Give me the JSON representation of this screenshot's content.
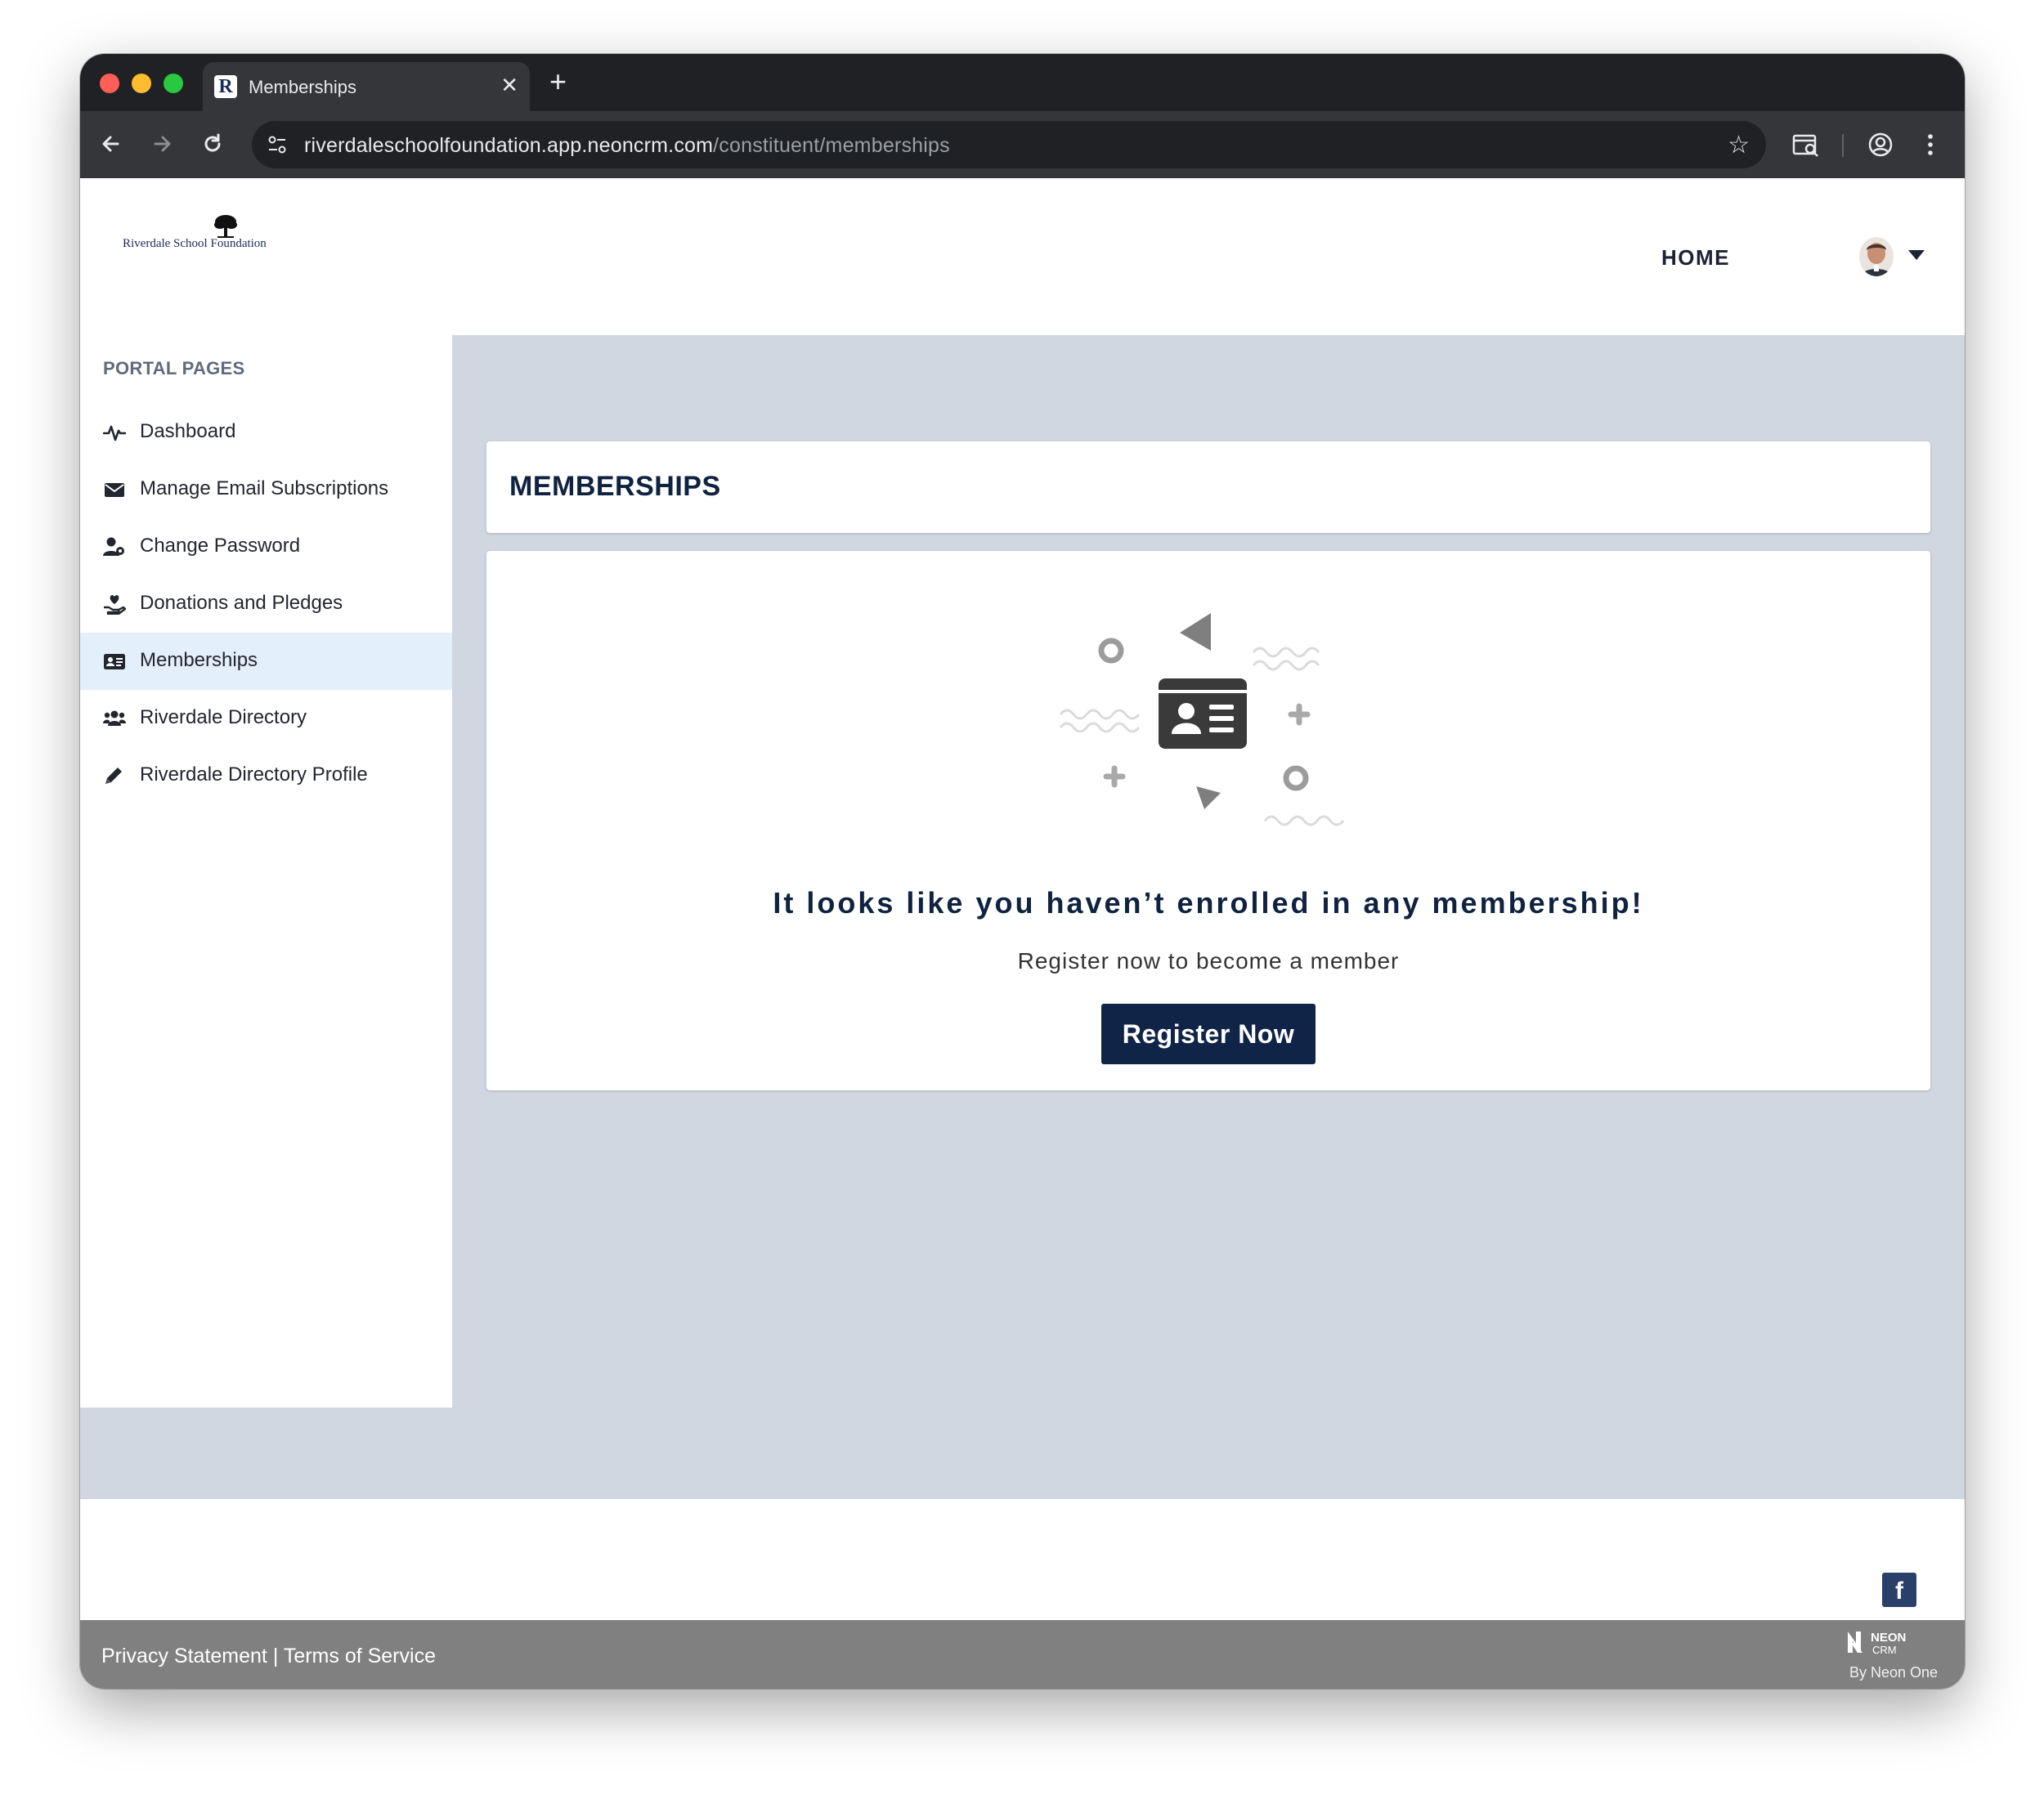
{
  "browser": {
    "tab_title": "Memberships",
    "favicon_letter": "R",
    "url_host": "riverdaleschoolfoundation.app.neoncrm.com",
    "url_path": "/constituent/memberships"
  },
  "header": {
    "logo_text": "Riverdale School Foundation",
    "home_label": "HOME"
  },
  "sidebar": {
    "heading": "PORTAL PAGES",
    "items": [
      {
        "label": "Dashboard",
        "icon": "pulse-icon"
      },
      {
        "label": "Manage Email Subscriptions",
        "icon": "envelope-icon"
      },
      {
        "label": "Change Password",
        "icon": "user-gear-icon"
      },
      {
        "label": "Donations and Pledges",
        "icon": "hand-heart-icon"
      },
      {
        "label": "Memberships",
        "icon": "id-card-icon",
        "active": true
      },
      {
        "label": "Riverdale Directory",
        "icon": "users-icon"
      },
      {
        "label": "Riverdale Directory Profile",
        "icon": "pencil-icon"
      }
    ]
  },
  "main": {
    "title": "MEMBERSHIPS",
    "empty_heading": "It looks like you haven’t enrolled in any membership!",
    "empty_sub": "Register now to become a member",
    "register_label": "Register Now"
  },
  "footer": {
    "privacy_label": "Privacy Statement",
    "separator": "|",
    "terms_label": "Terms of Service",
    "brand_by": "By Neon One",
    "brand_name": "NEON",
    "brand_sub": "CRM",
    "facebook_letter": "f"
  },
  "colors": {
    "accent": "#0f2447",
    "content_bg": "#d0d7e0",
    "active_item_bg": "#e3effb",
    "footer_bar": "#808080"
  }
}
